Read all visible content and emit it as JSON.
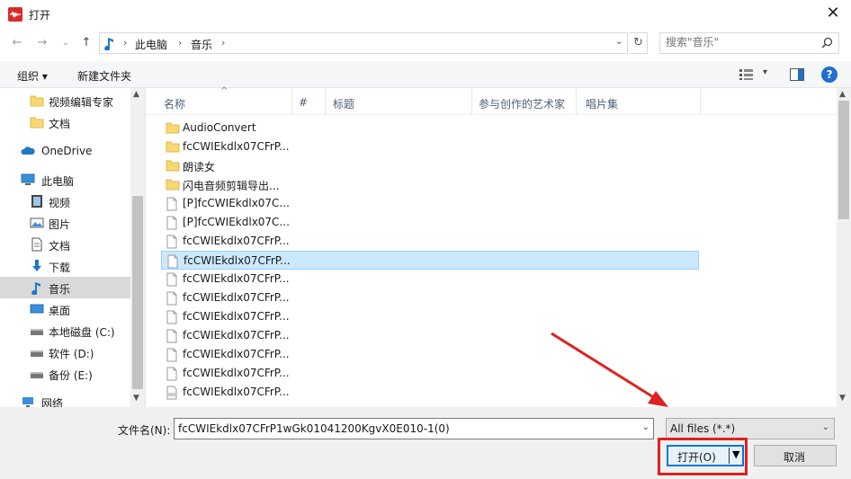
{
  "window": {
    "title": "打开",
    "close_glyph": "✕"
  },
  "nav": {
    "back_glyph": "←",
    "forward_glyph": "→",
    "recent_glyph": "⌄",
    "up_glyph": "↑",
    "breadcrumbs": [
      "此电脑",
      "音乐"
    ],
    "crumb_sep": "›",
    "search_placeholder": "搜索\"音乐\""
  },
  "toolbar": {
    "organize": "组织 ▾",
    "new_folder": "新建文件夹"
  },
  "sidebar": {
    "items": [
      {
        "label": "视频编辑专家",
        "icon": "folder-icon"
      },
      {
        "label": "文档",
        "icon": "folder-icon"
      },
      {
        "label": "OneDrive",
        "icon": "cloud-icon"
      },
      {
        "label": "此电脑",
        "icon": "computer-icon"
      },
      {
        "label": "视频",
        "icon": "video-icon"
      },
      {
        "label": "图片",
        "icon": "picture-icon"
      },
      {
        "label": "文档",
        "icon": "document-icon"
      },
      {
        "label": "下载",
        "icon": "download-icon"
      },
      {
        "label": "音乐",
        "icon": "music-icon",
        "selected": true
      },
      {
        "label": "桌面",
        "icon": "desktop-icon"
      },
      {
        "label": "本地磁盘 (C:)",
        "icon": "drive-icon"
      },
      {
        "label": "软件 (D:)",
        "icon": "drive-icon"
      },
      {
        "label": "备份 (E:)",
        "icon": "drive-icon"
      },
      {
        "label": "网络",
        "icon": "network-icon"
      }
    ]
  },
  "columns": [
    "名称",
    "#",
    "标题",
    "参与创作的艺术家",
    "唱片集"
  ],
  "files": [
    {
      "name": "AudioConvert",
      "type": "folder"
    },
    {
      "name": "fcCWIEkdlx07CFrP...",
      "type": "folder"
    },
    {
      "name": "朗读女",
      "type": "folder"
    },
    {
      "name": "闪电音频剪辑导出...",
      "type": "folder"
    },
    {
      "name": "[P]fcCWIEkdlx07C...",
      "type": "file"
    },
    {
      "name": "[P]fcCWIEkdlx07C...",
      "type": "file"
    },
    {
      "name": "fcCWIEkdlx07CFrP...",
      "type": "file"
    },
    {
      "name": "fcCWIEkdlx07CFrP...",
      "type": "file",
      "selected": true
    },
    {
      "name": "fcCWIEkdlx07CFrP...",
      "type": "file"
    },
    {
      "name": "fcCWIEkdlx07CFrP...",
      "type": "file"
    },
    {
      "name": "fcCWIEkdlx07CFrP...",
      "type": "file"
    },
    {
      "name": "fcCWIEkdlx07CFrP...",
      "type": "file"
    },
    {
      "name": "fcCWIEkdlx07CFrP...",
      "type": "file"
    },
    {
      "name": "fcCWIEkdlx07CFrP...",
      "type": "file"
    },
    {
      "name": "fcCWIEkdlx07CFrP...",
      "type": "wma"
    }
  ],
  "footer": {
    "filename_label": "文件名(N):",
    "filename_value": "fcCWIEkdlx07CFrP1wGk01041200KgvX0E010-1(0)",
    "filter_value": "All files (*.*)",
    "open_label": "打开(O)",
    "cancel_label": "取消"
  },
  "colors": {
    "accent": "#0078d7",
    "annotation": "#e02020",
    "folder": "#f8d775"
  }
}
